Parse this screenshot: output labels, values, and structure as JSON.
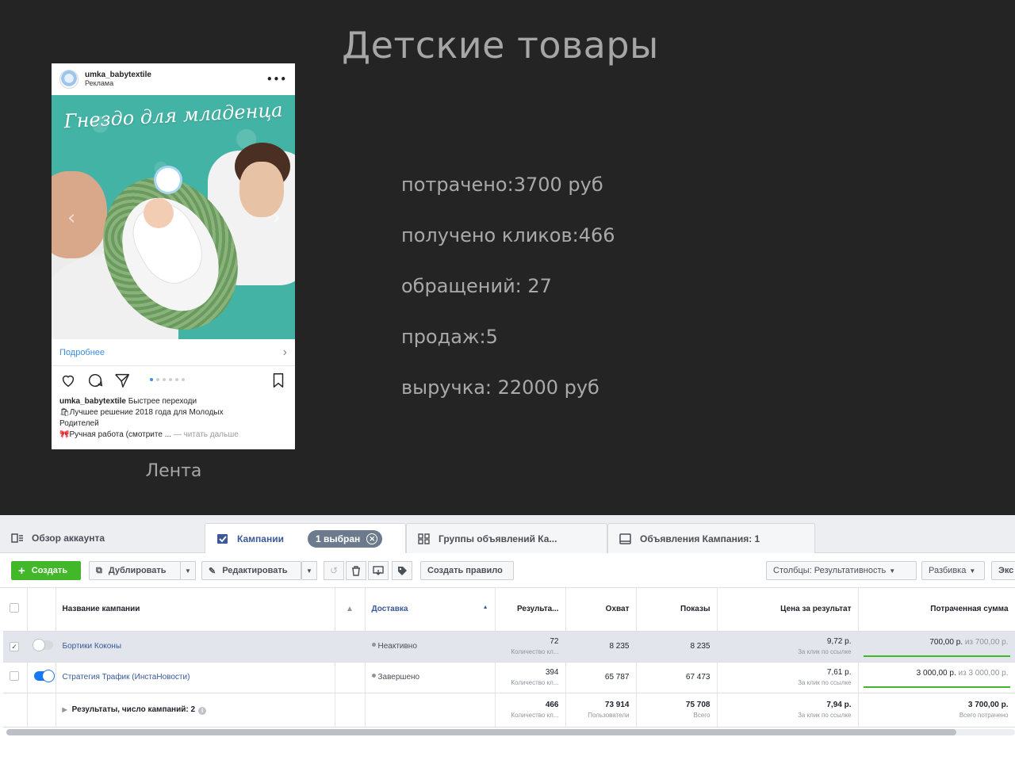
{
  "slide": {
    "title": "Детские товары",
    "caption": "Лента",
    "stats": [
      "потрачено:3700 руб",
      "получено кликов:466",
      "обращений: 27",
      "продаж:5",
      "выручка: 22000 руб"
    ]
  },
  "instagram_post": {
    "username": "umka_babytextile",
    "sponsored_label": "Реклама",
    "image_text": "Гнездо для младенца",
    "cta_label": "Подробнее",
    "carousel": {
      "count": 6,
      "active": 1
    },
    "caption_user": "umka_babytextile",
    "caption_lines": [
      "Быстрее переходи",
      "🛍Лучшее решение 2018 года для Молодых",
      "Родителей",
      "🎀Ручная работа (смотрите ..."
    ],
    "read_more": "— читать дальше"
  },
  "ads_manager": {
    "tabs": {
      "overview": "Обзор аккаунта",
      "campaigns": "Кампании",
      "selected_pill": "1 выбран",
      "adsets": "Группы объявлений Ка...",
      "ads": "Объявления Кампания: 1"
    },
    "toolbar": {
      "create": "Создать",
      "duplicate": "Дублировать",
      "edit": "Редактировать",
      "create_rule": "Создать правило",
      "columns": "Столбцы: Результативность",
      "breakdown": "Разбивка",
      "export": "Экс"
    },
    "columns": {
      "name": "Название кампании",
      "delivery": "Доставка",
      "results": "Результа...",
      "reach": "Охват",
      "impressions": "Показы",
      "cost_per_result": "Цена за результат",
      "amount_spent": "Потраченная сумма"
    },
    "rows": [
      {
        "selected": true,
        "enabled": false,
        "name": "Бортики Коконы",
        "delivery": "Неактивно",
        "results": "72",
        "results_sub": "Количество кл...",
        "reach": "8 235",
        "impressions": "8 235",
        "cost": "9,72 р.",
        "cost_sub": "За клик по ссылке",
        "spent": "700,00 р.",
        "spent_of": "из 700,00 р.",
        "spent_progress": 1.0
      },
      {
        "selected": false,
        "enabled": true,
        "name": "Стратегия Трафик (ИнстаНовости)",
        "delivery": "Завершено",
        "results": "394",
        "results_sub": "Количество кл...",
        "reach": "65 787",
        "impressions": "67 473",
        "cost": "7,61 р.",
        "cost_sub": "За клик по ссылке",
        "spent": "3 000,00 р.",
        "spent_of": "из 3 000,00 р.",
        "spent_progress": 1.0
      }
    ],
    "totals": {
      "label": "Результаты, число кампаний: 2",
      "results": "466",
      "results_sub": "Количество кл...",
      "reach": "73 914",
      "reach_sub": "Пользователи",
      "impressions": "75 708",
      "impressions_sub": "Всего",
      "cost": "7,94 р.",
      "cost_sub": "За клик по ссылке",
      "spent": "3 700,00 р.",
      "spent_sub": "Всего потрачено"
    },
    "colors": {
      "accent": "#3b5998",
      "create_green": "#42b72a",
      "toggle_on": "#1877f2"
    }
  }
}
